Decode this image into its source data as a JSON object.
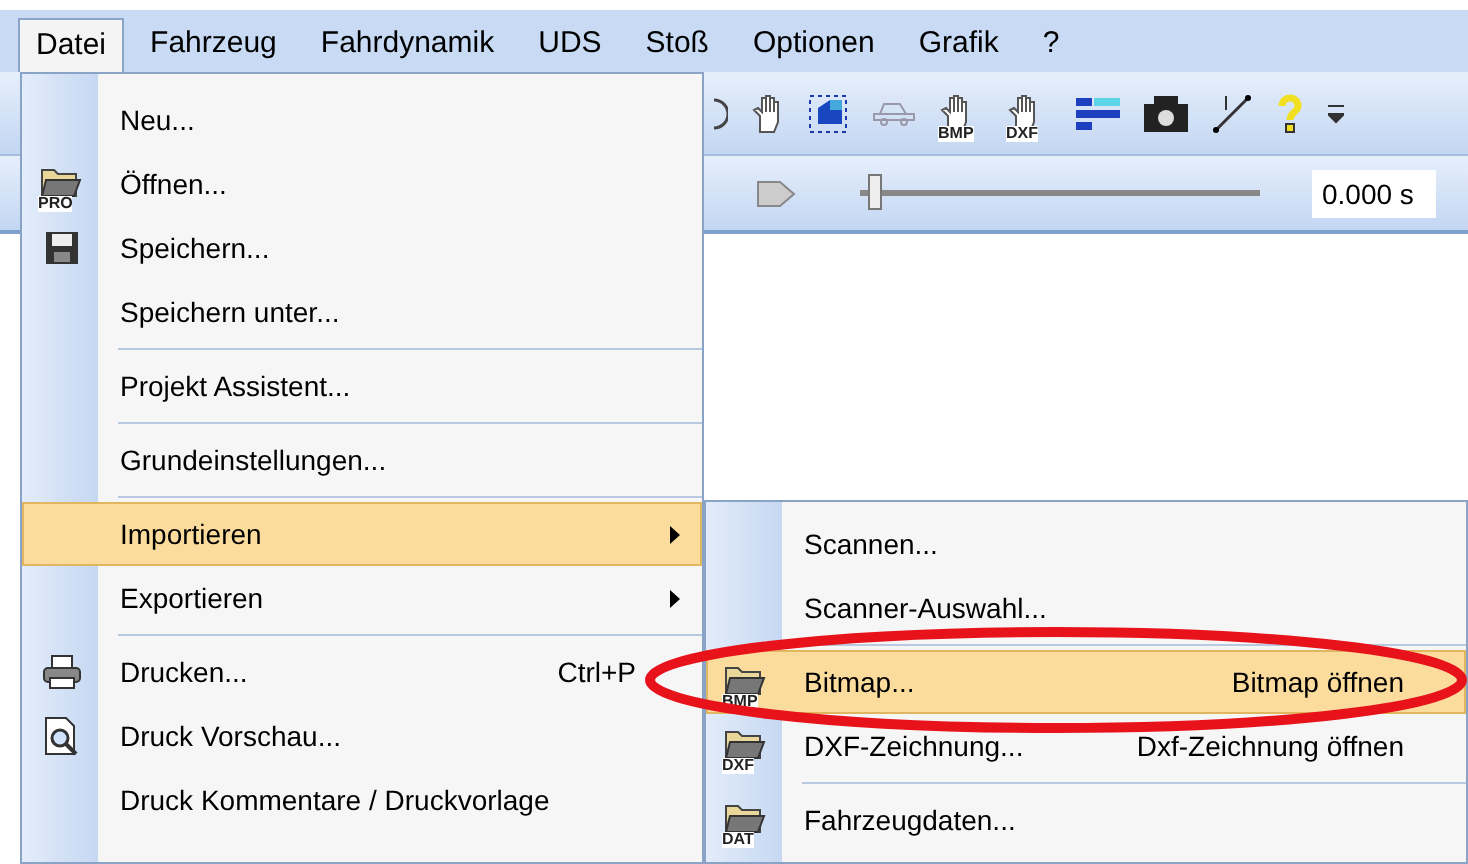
{
  "menubar": [
    {
      "label": "Datei",
      "selected": true
    },
    {
      "label": "Fahrzeug",
      "selected": false
    },
    {
      "label": "Fahrdynamik",
      "selected": false
    },
    {
      "label": "UDS",
      "selected": false
    },
    {
      "label": "Stoß",
      "selected": false
    },
    {
      "label": "Optionen",
      "selected": false
    },
    {
      "label": "Grafik",
      "selected": false
    },
    {
      "label": "?",
      "selected": false
    }
  ],
  "toolbar": {
    "icon_labels": [
      "BMP",
      "DXF"
    ],
    "playback": {
      "level": 0.02,
      "time": "0.000 s"
    }
  },
  "menu": [
    {
      "label": "Neu...",
      "selected": false,
      "separator_after": false
    },
    {
      "label": "Öffnen...",
      "icon_text": "PRO",
      "selected": false,
      "separator_after": false
    },
    {
      "label": "Speichern...",
      "selected": false,
      "separator_after": false
    },
    {
      "label": "Speichern unter...",
      "selected": false,
      "separator_after": true
    },
    {
      "label": "Projekt Assistent...",
      "selected": false,
      "separator_after": true
    },
    {
      "label": "Grundeinstellungen...",
      "selected": false,
      "separator_after": true
    },
    {
      "label": "Importieren",
      "submenu": true,
      "selected": true,
      "separator_after": false
    },
    {
      "label": "Exportieren",
      "submenu": true,
      "selected": false,
      "separator_after": true
    },
    {
      "label": "Drucken...",
      "shortcut": "Ctrl+P",
      "selected": false,
      "separator_after": false
    },
    {
      "label": "Druck Vorschau...",
      "selected": false,
      "separator_after": false
    },
    {
      "label": "Druck Kommentare / Druckvorlage",
      "selected": false,
      "separator_after": false
    }
  ],
  "submenu": [
    {
      "label": "Scannen...",
      "selected": false,
      "separator_after": false
    },
    {
      "label": "Scanner-Auswahl...",
      "selected": false,
      "separator_after": true
    },
    {
      "label": "Bitmap...",
      "hint": "Bitmap öffnen",
      "icon_text": "BMP",
      "selected": true,
      "separator_after": false
    },
    {
      "label": "DXF-Zeichnung...",
      "hint": "Dxf-Zeichnung öffnen",
      "icon_text": "DXF",
      "selected": false,
      "separator_after": true
    },
    {
      "label": "Fahrzeugdaten...",
      "icon_text": "DAT",
      "selected": false,
      "separator_after": false
    }
  ]
}
